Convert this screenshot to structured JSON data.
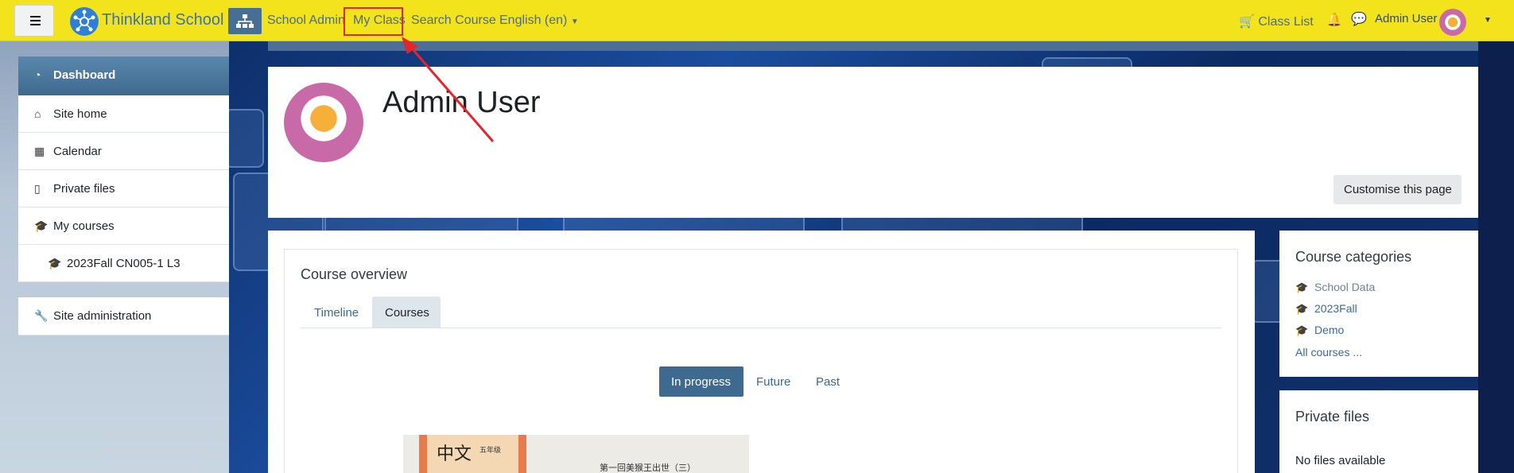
{
  "navbar": {
    "brand_name": "Thinkland School",
    "links": [
      "School Admin",
      "My Class",
      "Search Course",
      "English (en)"
    ],
    "class_list": "Class List",
    "user_name": "Admin User",
    "accent_color": "#f2e31c"
  },
  "nav_drawer": {
    "items": [
      {
        "label": "Dashboard",
        "icon": "dashboard-icon"
      },
      {
        "label": "Site home",
        "icon": "home-icon"
      },
      {
        "label": "Calendar",
        "icon": "calendar-icon"
      },
      {
        "label": "Private files",
        "icon": "file-icon"
      },
      {
        "label": "My courses",
        "icon": "graduation-cap-icon"
      },
      {
        "label": "2023Fall CN005-1 L3",
        "icon": "graduation-cap-icon"
      }
    ],
    "admin_label": "Site administration"
  },
  "header": {
    "user_title": "Admin User",
    "customise_label": "Customise this page"
  },
  "course_overview": {
    "title": "Course overview",
    "tabs": [
      "Timeline",
      "Courses"
    ],
    "filters": [
      "In progress",
      "Future",
      "Past"
    ],
    "course_image_text": {
      "title": "中文",
      "subtitle": "五年级",
      "line": "第一回美猴王出世（三）"
    }
  },
  "course_categories": {
    "title": "Course categories",
    "items": [
      "School Data",
      "2023Fall",
      "Demo"
    ],
    "all_link": "All courses ..."
  },
  "private_files": {
    "title": "Private files",
    "empty_text": "No files available"
  }
}
